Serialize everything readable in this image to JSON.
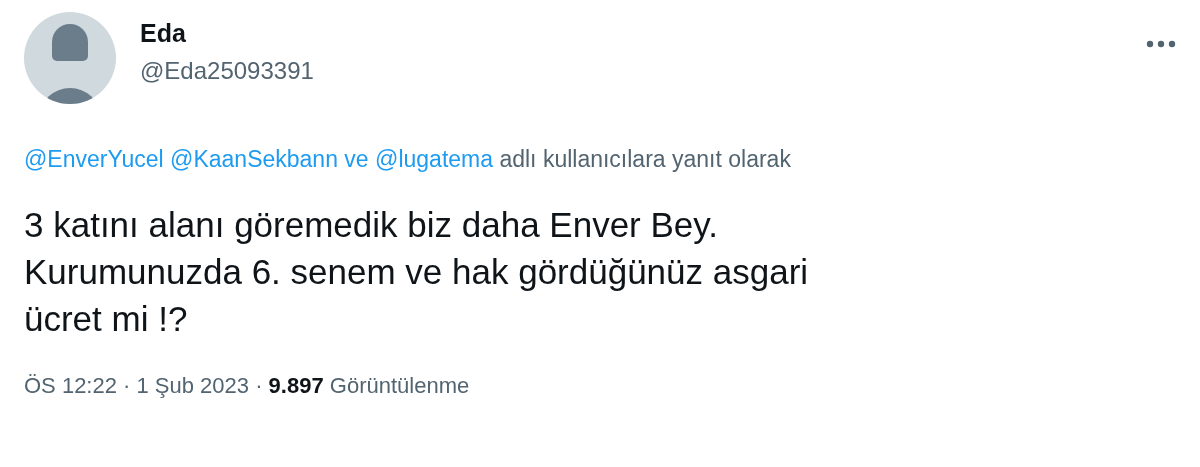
{
  "author": {
    "name": "Eda",
    "handle": "@Eda25093391"
  },
  "reply_to": {
    "mentions": [
      "@EnverYucel",
      "@KaanSekbann",
      "@lugatema"
    ],
    "joiner": "ve",
    "suffix": "adlı kullanıcılara yanıt olarak"
  },
  "tweet_lines": [
    "3 katını alanı göremedik biz daha Enver Bey.",
    "Kurumunuzda 6. senem ve hak gördüğünüz asgari",
    "ücret mi !?"
  ],
  "meta": "ÖS 12:22 · 1 Şub 2023 · **9.897** Görüntülenme"
}
